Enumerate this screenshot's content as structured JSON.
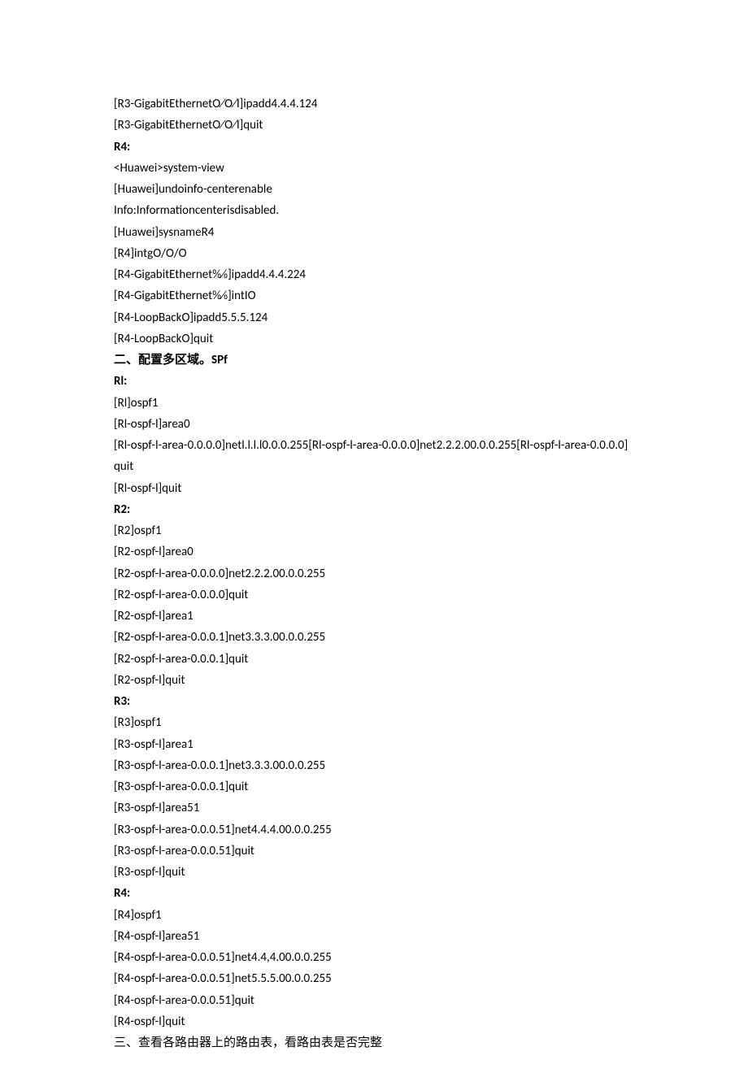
{
  "lines": [
    {
      "text": "[R3-GigabitEthernetO⁄O⁄l]ipadd4.4.4.124",
      "bold": false
    },
    {
      "text": "[R3-GigabitEthernetO⁄O⁄l]quit",
      "bold": false
    },
    {
      "text": "R4:",
      "bold": true
    },
    {
      "text": "<Huawei>system-view",
      "bold": false
    },
    {
      "text": "[Huawei]undoinfo-centerenable",
      "bold": false
    },
    {
      "text": "Info:Informationcenterisdisabled.",
      "bold": false
    },
    {
      "text": "[Huawei]sysnameR4",
      "bold": false
    },
    {
      "text": "[R4]intgO/O/O",
      "bold": false
    },
    {
      "text": "[R4-GigabitEthernet0⁄0⁄0]ipadd4.4.4.224",
      "bold": false
    },
    {
      "text": "[R4-GigabitEthernet0⁄0⁄0]intIO",
      "bold": false
    },
    {
      "text": "[R4-LoopBackO]ipadd5.5.5.124",
      "bold": false
    },
    {
      "text": "[R4-LoopBackO]quit",
      "bold": false
    },
    {
      "text": "二、配置多区域。SPf",
      "bold": true
    },
    {
      "text": "Rl:",
      "bold": true
    },
    {
      "text": "[Rl]ospf1",
      "bold": false
    },
    {
      "text": "[Rl-ospf-l]area0",
      "bold": false
    },
    {
      "text": "[Rl-ospf-l-area-0.0.0.0]netl.l.l.l0.0.0.255[Rl-ospf-l-area-0.0.0.0]net2.2.2.00.0.0.255[Rl-ospf-l-area-0.0.0.0]quit",
      "bold": false
    },
    {
      "text": "[Rl-ospf-l]quit",
      "bold": false
    },
    {
      "text": "R2:",
      "bold": true
    },
    {
      "text": "[R2]ospf1",
      "bold": false
    },
    {
      "text": "[R2-ospf-l]area0",
      "bold": false
    },
    {
      "text": "[R2-ospf-l-area-0.0.0.0]net2.2.2.00.0.0.255",
      "bold": false
    },
    {
      "text": "[R2-ospf-l-area-0.0.0.0]quit",
      "bold": false
    },
    {
      "text": "[R2-ospf-l]area1",
      "bold": false
    },
    {
      "text": "[R2-ospf-l-area-0.0.0.1]net3.3.3.00.0.0.255",
      "bold": false
    },
    {
      "text": "[R2-ospf-l-area-0.0.0.1]quit",
      "bold": false
    },
    {
      "text": "[R2-ospf-l]quit",
      "bold": false
    },
    {
      "text": "R3:",
      "bold": true
    },
    {
      "text": "[R3]ospf1",
      "bold": false
    },
    {
      "text": "[R3-ospf-l]area1",
      "bold": false
    },
    {
      "text": "[R3-ospf-l-area-0.0.0.1]net3.3.3.00.0.0.255",
      "bold": false
    },
    {
      "text": "[R3-ospf-l-area-0.0.0.1]quit",
      "bold": false
    },
    {
      "text": "[R3-ospf-l]area51",
      "bold": false
    },
    {
      "text": "[R3-ospf-l-area-0.0.0.51]net4.4.4.00.0.0.255",
      "bold": false
    },
    {
      "text": "[R3-ospf-l-area-0.0.0.51]quit",
      "bold": false
    },
    {
      "text": "[R3-ospf-l]quit",
      "bold": false
    },
    {
      "text": "R4:",
      "bold": true
    },
    {
      "text": "[R4]ospf1",
      "bold": false
    },
    {
      "text": "[R4-ospf-l]area51",
      "bold": false
    },
    {
      "text": "[R4-ospf-l-area-0.0.0.51]net4.4,4.00.0.0.255",
      "bold": false
    },
    {
      "text": "[R4-ospf-l-area-0.0.0.51]net5.5.5.00.0.0.255",
      "bold": false
    },
    {
      "text": "[R4-ospf-l-area-0.0.0.51]quit",
      "bold": false
    },
    {
      "text": "[R4-ospf-l]quit",
      "bold": false
    },
    {
      "text": "三、查看各路由器上的路由表，看路由表是否完整",
      "bold": false
    }
  ]
}
